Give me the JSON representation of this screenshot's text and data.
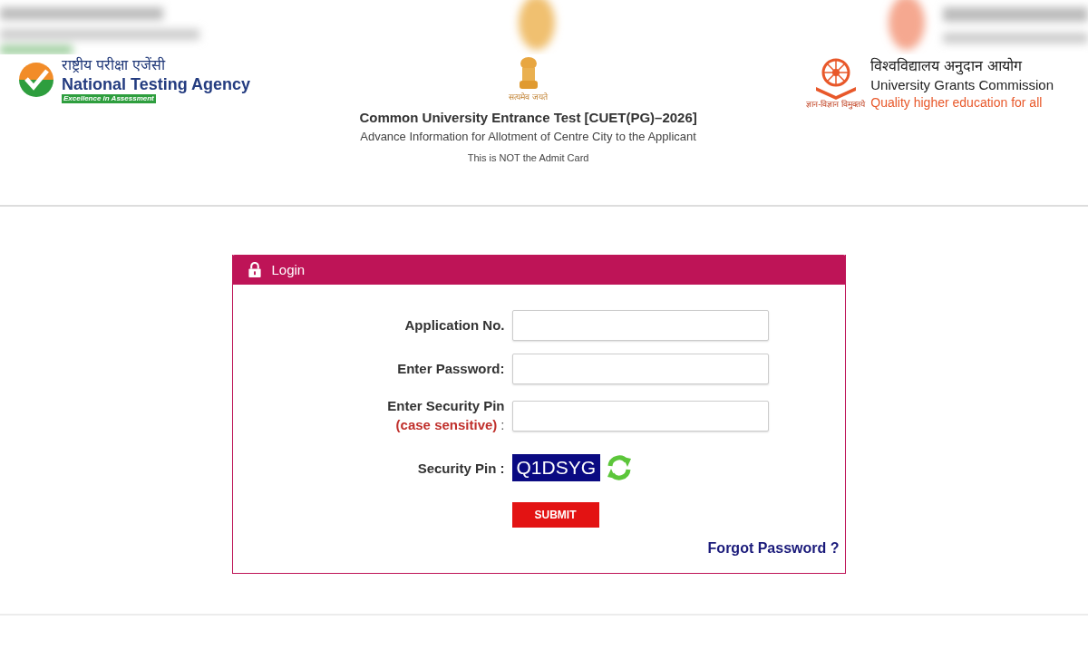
{
  "header": {
    "nta": {
      "hindi": "राष्ट्रीय परीक्षा एजेंसी",
      "name": "National Testing Agency",
      "tagline": "Excellence in Assessment"
    },
    "emblem": {
      "motto": "सत्यमेव जयते"
    },
    "title": "Common University Entrance Test [CUET(PG)–2026]",
    "subtitle": "Advance Information for Allotment of Centre City to the Applicant",
    "notice": "This is NOT the Admit Card",
    "ugc": {
      "hindi": "विश्वविद्यालय अनुदान आयोग",
      "name": "University Grants Commission",
      "tagline": "Quality higher education for all",
      "motto": "ज्ञान-विज्ञान विमुक्तये"
    }
  },
  "login": {
    "title": "Login",
    "fields": [
      {
        "label": "Application No."
      },
      {
        "label": "Enter Password:"
      },
      {
        "label": "Enter Security Pin",
        "note": "(case sensitive)",
        "suffix": ":"
      }
    ],
    "captcha": {
      "label": "Security Pin :",
      "code": "Q1DSYG"
    },
    "submit": "SUBMIT",
    "forgot": "Forgot Password ?"
  }
}
